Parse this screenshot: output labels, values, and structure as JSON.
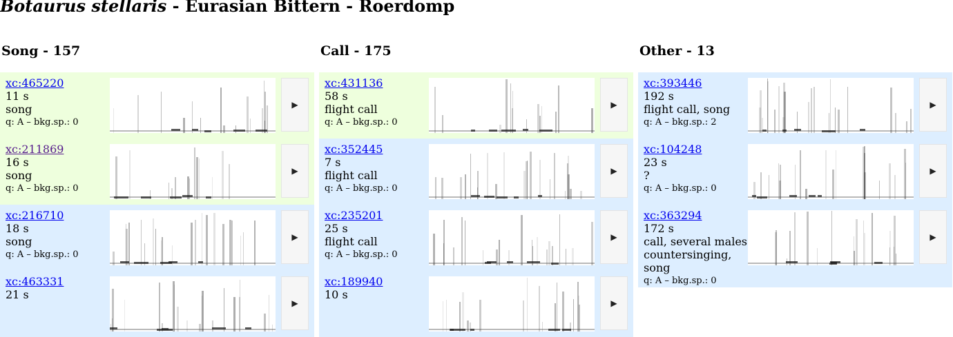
{
  "title": {
    "scientific": "Botaurus stellaris",
    "rest": " - Eurasian Bittern - Roerdomp"
  },
  "play_glyph": "▶",
  "columns": [
    {
      "heading": "Song - 157",
      "recordings": [
        {
          "id": "xc:465220",
          "duration": "11 s",
          "type": "song",
          "quality": "q: A – bkg.sp.: 0",
          "bg": "green",
          "visited": false
        },
        {
          "id": "xc:211869",
          "duration": "16 s",
          "type": "song",
          "quality": "q: A – bkg.sp.: 0",
          "bg": "green",
          "visited": true
        },
        {
          "id": "xc:216710",
          "duration": "18 s",
          "type": "song",
          "quality": "q: A – bkg.sp.: 0",
          "bg": "blue",
          "visited": false
        },
        {
          "id": "xc:463331",
          "duration": "21 s",
          "type": "",
          "quality": "",
          "bg": "blue",
          "visited": false
        }
      ]
    },
    {
      "heading": "Call - 175",
      "recordings": [
        {
          "id": "xc:431136",
          "duration": "58 s",
          "type": "flight call",
          "quality": "q: A – bkg.sp.: 0",
          "bg": "green",
          "visited": false
        },
        {
          "id": "xc:352445",
          "duration": "7 s",
          "type": "flight call",
          "quality": "q: A – bkg.sp.: 0",
          "bg": "blue",
          "visited": false
        },
        {
          "id": "xc:235201",
          "duration": "25 s",
          "type": "flight call",
          "quality": "q: A – bkg.sp.: 0",
          "bg": "blue",
          "visited": false
        },
        {
          "id": "xc:189940",
          "duration": "10 s",
          "type": "",
          "quality": "",
          "bg": "blue",
          "visited": false
        }
      ]
    },
    {
      "heading": "Other - 13",
      "recordings": [
        {
          "id": "xc:393446",
          "duration": "192 s",
          "type": "flight call, song",
          "quality": "q: A – bkg.sp.: 2",
          "bg": "blue",
          "visited": false
        },
        {
          "id": "xc:104248",
          "duration": "23 s",
          "type": "?",
          "quality": "q: A – bkg.sp.: 0",
          "bg": "blue",
          "visited": false
        },
        {
          "id": "xc:363294",
          "duration": "172 s",
          "type": "call, several males countersinging, song",
          "quality": "q: A – bkg.sp.: 0",
          "bg": "blue",
          "visited": false
        }
      ]
    }
  ]
}
